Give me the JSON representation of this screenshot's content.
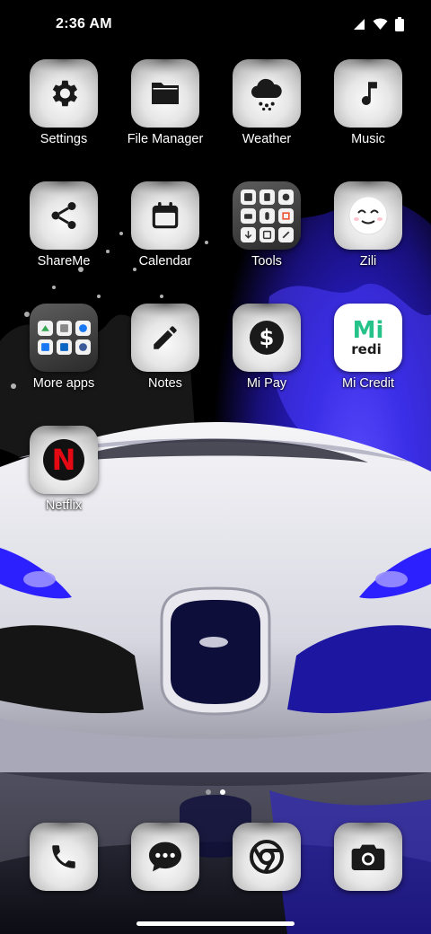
{
  "status_bar": {
    "time": "2:36 AM",
    "icons": [
      "signal-icon",
      "wifi-icon",
      "battery-icon"
    ]
  },
  "apps": [
    {
      "label": "Settings",
      "icon": "gear-icon"
    },
    {
      "label": "File Manager",
      "icon": "folder-icon"
    },
    {
      "label": "Weather",
      "icon": "cloud-rain-icon"
    },
    {
      "label": "Music",
      "icon": "music-note-icon"
    },
    {
      "label": "ShareMe",
      "icon": "share-icon"
    },
    {
      "label": "Calendar",
      "icon": "calendar-icon"
    },
    {
      "label": "Tools",
      "icon": "tools-folder-icon"
    },
    {
      "label": "Zili",
      "icon": "zili-face-icon"
    },
    {
      "label": "More apps",
      "icon": "more-apps-folder-icon"
    },
    {
      "label": "Notes",
      "icon": "pencil-icon"
    },
    {
      "label": "Mi Pay",
      "icon": "dollar-icon"
    },
    {
      "label": "Mi Credit",
      "icon": "mi-credit-icon",
      "logo_text": "Mi",
      "logo_sub": "redi"
    },
    {
      "label": "Netflix",
      "icon": "netflix-icon",
      "logo_text": "N"
    }
  ],
  "page_indicator": {
    "pages": 2,
    "current": 2
  },
  "dock": [
    {
      "name": "phone",
      "icon": "phone-icon"
    },
    {
      "name": "messages",
      "icon": "message-icon"
    },
    {
      "name": "browser",
      "icon": "chrome-icon"
    },
    {
      "name": "camera",
      "icon": "camera-icon"
    }
  ],
  "colors": {
    "wallpaper_blue": "#2a1fd6",
    "wallpaper_white": "#e8e8ee",
    "tile_light": "#f2f2f2",
    "mi_green": "#25c28a",
    "netflix_red": "#e50914"
  }
}
